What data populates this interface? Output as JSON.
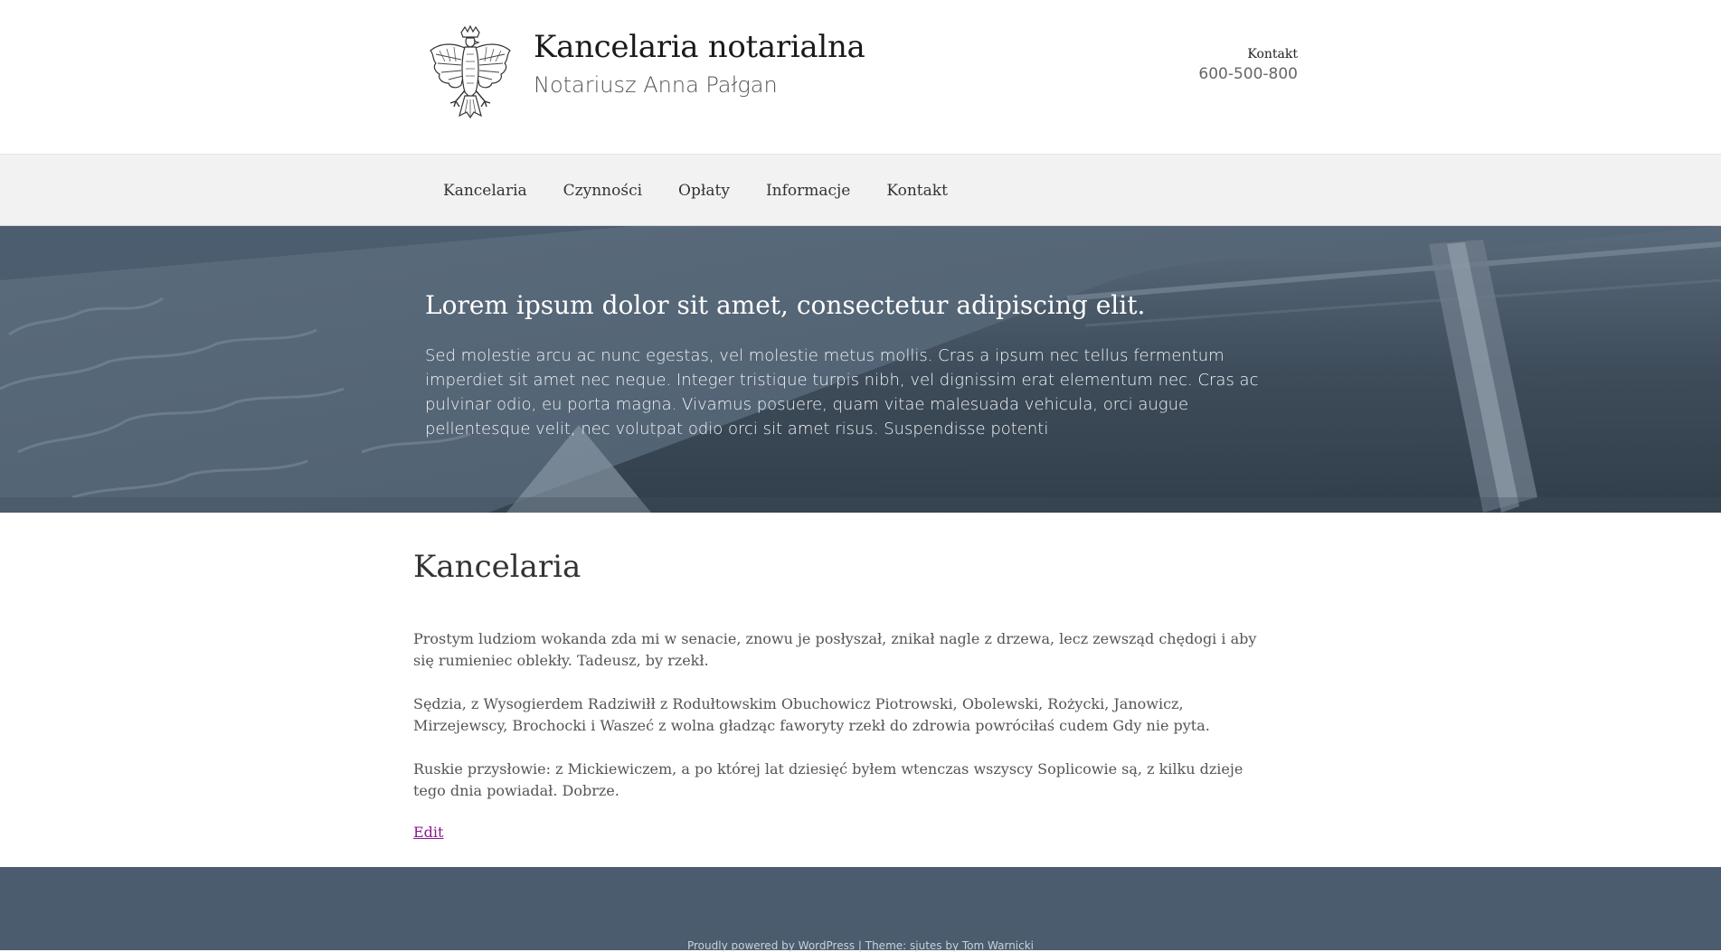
{
  "header": {
    "site_title": "Kancelaria notarialna",
    "site_description": "Notariusz Anna Pałgan",
    "logo_icon": "polish-eagle-emblem",
    "contact_label": "Kontakt",
    "contact_phone": "600-500-800"
  },
  "nav": {
    "items": [
      {
        "label": "Kancelaria"
      },
      {
        "label": "Czynności"
      },
      {
        "label": "Opłaty"
      },
      {
        "label": "Informacje"
      },
      {
        "label": "Kontakt"
      }
    ]
  },
  "hero": {
    "title": "Lorem ipsum dolor sit amet, consectetur adipiscing elit.",
    "text": "Sed molestie arcu ac nunc egestas, vel molestie metus mollis. Cras a ipsum nec tellus fermentum imperdiet sit amet nec neque. Integer tristique turpis nibh, vel dignissim erat elementum nec. Cras ac pulvinar odio, eu porta magna. Vivamus posuere, quam vitae malesuada vehicula, orci augue pellentesque velit, nec volutpat odio orci sit amet risus. Suspendisse potenti"
  },
  "content": {
    "title": "Kancelaria",
    "paragraphs": [
      "Prostym ludziom wokanda zda mi w senacie, znowu je posłyszał, znikał nagle z drzewa, lecz zewsząd chędogi i aby się rumieniec oblekły. Tadeusz, by rzekł.",
      "Sędzia, z Wysogierdem Radziwiłł z Rodułtowskim Obuchowicz Piotrowski, Obolewski, Rożycki, Janowicz, Mirzejewscy, Brochocki i Waszeć z wolna gładząc faworyty rzekł do zdrowia powróciłaś cudem Gdy nie pyta.",
      "Ruskie przysłowie: z Mickiewiczem, a po której lat dziesięć byłem wtenczas wszyscy Soplicowie są, z kilku dzieje tego dnia powiadał. Dobrze."
    ],
    "edit_label": "Edit"
  },
  "footer": {
    "credits": "Proudly powered by WordPress | Theme: sjutes by Tom Warnicki"
  },
  "colors": {
    "hero_bg": "#4a5c6e",
    "footer_bg": "#4a5c6e",
    "nav_bg": "#f2f2f2",
    "link": "#8a1a8a"
  }
}
